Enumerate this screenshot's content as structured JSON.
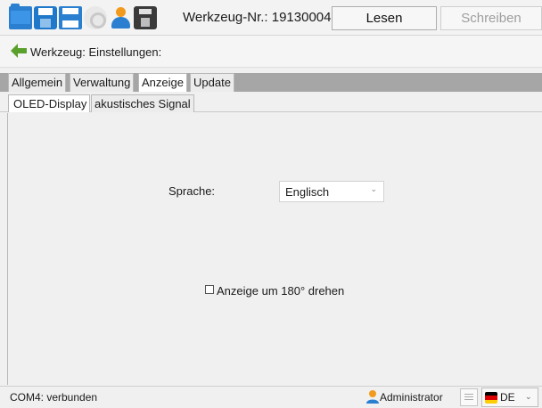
{
  "toolbar": {
    "icons": [
      "folder-open-icon",
      "save-icon",
      "printer-icon",
      "gear-icon",
      "user-icon",
      "device-icon"
    ],
    "tool_number_label": "Werkzeug-Nr.: 19130004",
    "read_button": "Lesen",
    "write_button": "Schreiben"
  },
  "header": {
    "title": "Werkzeug: Einstellungen:"
  },
  "tabs": [
    {
      "label": "Allgemein",
      "active": false
    },
    {
      "label": "Verwaltung",
      "active": false
    },
    {
      "label": "Anzeige",
      "active": true
    },
    {
      "label": "Update",
      "active": false
    }
  ],
  "subtabs": [
    {
      "label": "OLED-Display",
      "active": true
    },
    {
      "label": "akustisches Signal",
      "active": false
    }
  ],
  "content": {
    "language_label": "Sprache:",
    "language_value": "Englisch",
    "rotate_label": "Anzeige um 180° drehen",
    "rotate_checked": false
  },
  "statusbar": {
    "connection": "COM4: verbunden",
    "user_role": "Administrator",
    "language_code": "DE"
  },
  "colors": {
    "accent_blue": "#2b7fd0",
    "back_arrow_green": "#5aa02c",
    "tab_strip": "#a6a6a6"
  }
}
